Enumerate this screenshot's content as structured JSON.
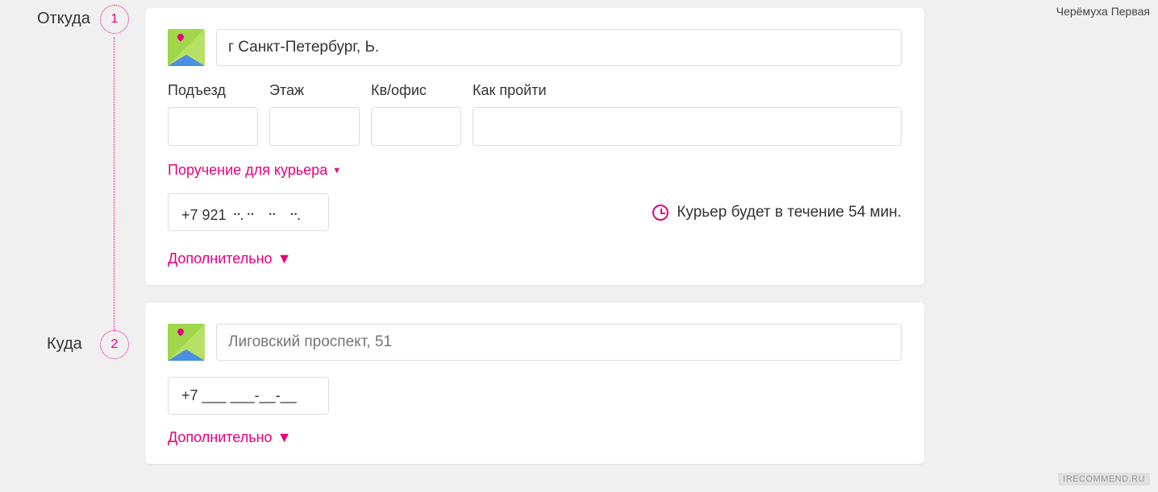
{
  "watermark_top": "Черёмуха Первая",
  "watermark_bottom": "IRECOMMEND.RU",
  "steps": {
    "from": {
      "label": "Откуда",
      "number": "1"
    },
    "to": {
      "label": "Куда",
      "number": "2"
    }
  },
  "from_card": {
    "address": "г Санкт-Петербург, Ь.",
    "fields": {
      "entrance_label": "Подъезд",
      "floor_label": "Этаж",
      "apt_label": "Кв/офис",
      "directions_label": "Как пройти"
    },
    "courier_task": "Поручение для курьера",
    "phone": "+7 921 ᠃.᠃   ᠃   ᠃.",
    "eta": "Курьер будет в течение 54 мин.",
    "additional": "Дополнительно"
  },
  "to_card": {
    "address_placeholder": "Лиговский проспект, 51",
    "phone": "+7 ___ ___-__-__",
    "additional": "Дополнительно"
  }
}
